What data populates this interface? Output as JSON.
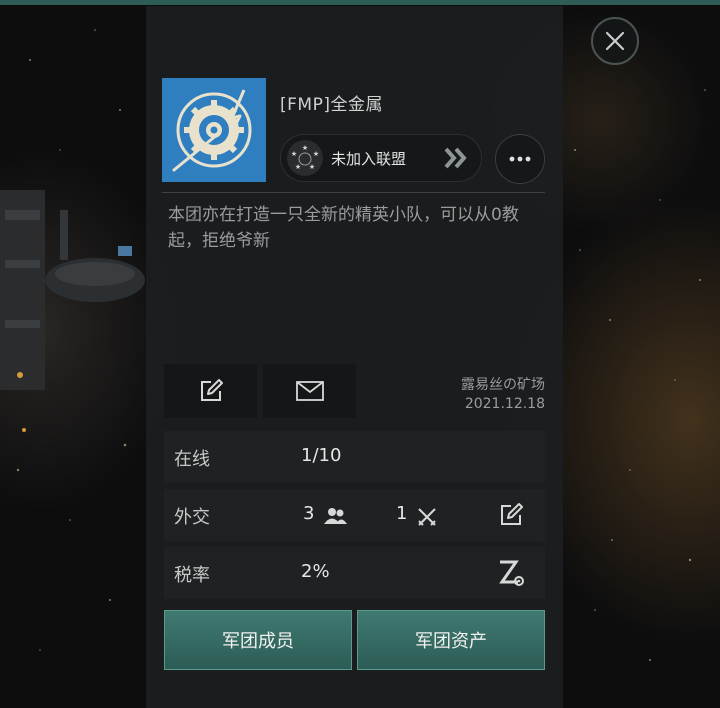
{
  "corp": {
    "name": "[FMP]全金属",
    "alliance_label": "未加入联盟",
    "description": "本团亦在打造一只全新的精英小队，可以从0教起，拒绝爷新",
    "location_name": "露易丝の矿场",
    "location_date": "2021.12.18"
  },
  "stats": {
    "online_label": "在线",
    "online_value": "1/10",
    "diplomacy_label": "外交",
    "friends_count": "3",
    "enemies_count": "1",
    "tax_label": "税率",
    "tax_value": "2%"
  },
  "actions": {
    "members_label": "军团成员",
    "assets_label": "军团资产"
  },
  "colors": {
    "accent_teal": "#3f7a70",
    "logo_blue": "#2f7fc0",
    "panel_bg": "#1c1e1f"
  },
  "icons": {
    "close": "close-icon",
    "edit": "pencil-edit-icon",
    "mail": "envelope-icon",
    "more": "more-dots-icon",
    "alliance": "alliance-stars-icon",
    "tax_settings": "tax-z-gear-icon"
  }
}
